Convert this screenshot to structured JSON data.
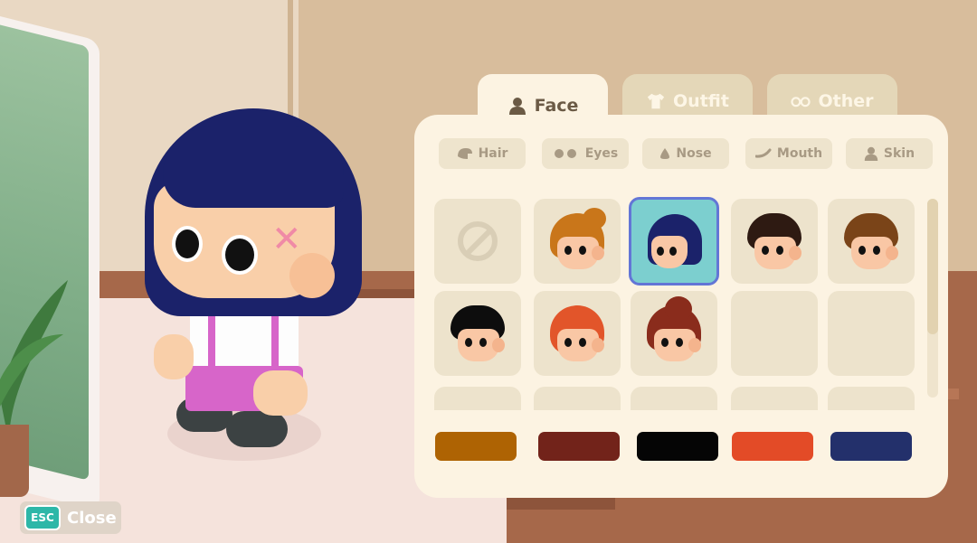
{
  "tabs": [
    {
      "label": "Face",
      "icon": "person-icon",
      "active": true
    },
    {
      "label": "Outfit",
      "icon": "shirt-icon",
      "active": false
    },
    {
      "label": "Other",
      "icon": "glasses-icon",
      "active": false
    }
  ],
  "subtabs": [
    {
      "label": "Hair",
      "icon": "hair-icon"
    },
    {
      "label": "Eyes",
      "icon": "eyes-icon"
    },
    {
      "label": "Nose",
      "icon": "nose-icon"
    },
    {
      "label": "Mouth",
      "icon": "mouth-icon"
    },
    {
      "label": "Skin",
      "icon": "person-icon"
    }
  ],
  "hair_options": [
    {
      "style": "none",
      "color": null,
      "selected": false
    },
    {
      "style": "bun",
      "color": "#c9761a",
      "selected": false
    },
    {
      "style": "bob",
      "color": "#1b226a",
      "selected": true
    },
    {
      "style": "swoop",
      "color": "#2e1a12",
      "selected": false
    },
    {
      "style": "short",
      "color": "#7a4418",
      "selected": false
    },
    {
      "style": "buzz",
      "color": "#0d0d0d",
      "selected": false
    },
    {
      "style": "wavy",
      "color": "#e2552a",
      "selected": false
    },
    {
      "style": "updo",
      "color": "#8a2c1c",
      "selected": false
    },
    {
      "style": "empty",
      "color": null,
      "selected": false
    },
    {
      "style": "empty",
      "color": null,
      "selected": false
    }
  ],
  "color_swatches": [
    "#ae6303",
    "#72231a",
    "#050505",
    "#e34b27",
    "#23306b"
  ],
  "close_button": {
    "key_label": "ESC",
    "label": "Close"
  },
  "colors": {
    "panel": "#fcf3e2",
    "tile": "#ede3cc",
    "selected_tile": "#7ccfcf",
    "selected_border": "#6376d6",
    "esc_key": "#2db7a8"
  }
}
